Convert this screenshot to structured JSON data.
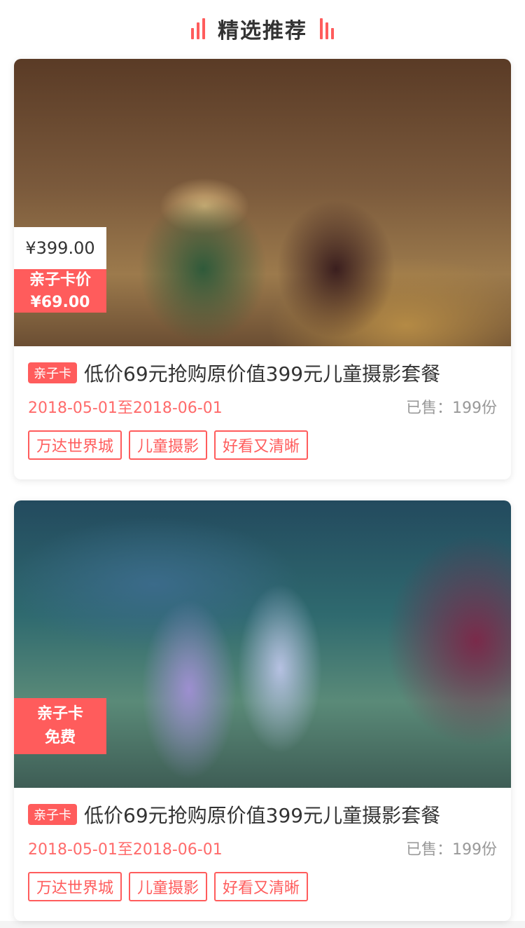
{
  "header": {
    "title": "精选推荐"
  },
  "cards": [
    {
      "original_price": "¥399.00",
      "promo_line1": "亲子卡价",
      "promo_line2": "¥69.00",
      "badge": "亲子卡",
      "title": "低价69元抢购原价值399元儿童摄影套餐",
      "date": "2018-05-01至2018-06-01",
      "sold": "已售：199份",
      "tags": [
        "万达世界城",
        "儿童摄影",
        "好看又清晰"
      ]
    },
    {
      "promo_line1": "亲子卡",
      "promo_line2": "免费",
      "badge": "亲子卡",
      "title": "低价69元抢购原价值399元儿童摄影套餐",
      "date": "2018-05-01至2018-06-01",
      "sold": "已售：199份",
      "tags": [
        "万达世界城",
        "儿童摄影",
        "好看又清晰"
      ]
    }
  ],
  "colors": {
    "accent": "#ff5c5c",
    "date": "#ff6b6b",
    "muted": "#999999"
  }
}
